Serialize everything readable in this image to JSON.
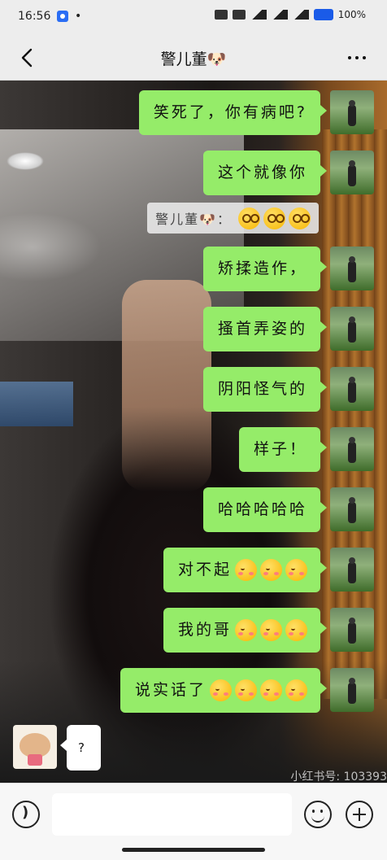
{
  "status_bar": {
    "time": "16:56",
    "dot": "•",
    "battery": "100%"
  },
  "header": {
    "title": "警儿董🐶"
  },
  "messages_out": [
    {
      "text": "笑死了，你有病吧?",
      "emoji": []
    },
    {
      "text": "这个就像你",
      "emoji": []
    },
    {
      "text": "矫揉造作，",
      "emoji": []
    },
    {
      "text": "搔首弄姿的",
      "emoji": []
    },
    {
      "text": "阴阳怪气的",
      "emoji": []
    },
    {
      "text": "样子！",
      "emoji": []
    },
    {
      "text": "哈哈哈哈哈",
      "emoji": []
    },
    {
      "text": "对不起",
      "emoji": [
        "blush",
        "blush",
        "blush"
      ]
    },
    {
      "text": "我的哥",
      "emoji": [
        "blush",
        "blush",
        "blush"
      ]
    },
    {
      "text": "说实话了",
      "emoji": [
        "blush",
        "blush",
        "blush",
        "blush"
      ]
    }
  ],
  "quote": {
    "sender": "警儿董🐶：",
    "emoji": [
      "dizzy",
      "dizzy",
      "dizzy"
    ]
  },
  "incoming": {
    "text": "?"
  },
  "watermark": "小红书号: 103393",
  "input": {
    "value": ""
  }
}
